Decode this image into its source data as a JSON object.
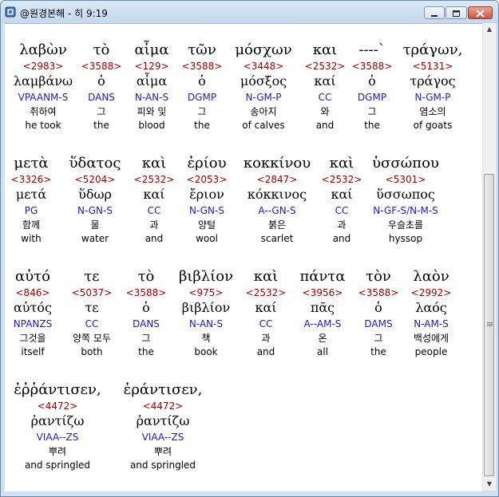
{
  "window": {
    "title": "@원경본해 - 히 9:19"
  },
  "words": [
    {
      "greek": "λαβὼν",
      "strong": "<2983>",
      "lemma": "λαμβάνω",
      "morph": "VPAANM-S",
      "korean": "취하여",
      "english": "he took"
    },
    {
      "greek": "τὸ",
      "strong": "<3588>",
      "lemma": "ὁ",
      "morph": "DANS",
      "korean": "그",
      "english": "the"
    },
    {
      "greek": "αἷμα",
      "strong": "<129>",
      "lemma": "αἷμα",
      "morph": "N-AN-S",
      "korean": "피와 및",
      "english": "blood"
    },
    {
      "greek": "τῶν",
      "strong": "<3588>",
      "lemma": "ὁ",
      "morph": "DGMP",
      "korean": "그",
      "english": "the"
    },
    {
      "greek": "μόσχων",
      "strong": "<3448>",
      "lemma": "μόσξος",
      "morph": "N-GM-P",
      "korean": "송아지",
      "english": "of calves"
    },
    {
      "greek": "και",
      "strong": "<2532>",
      "lemma": "καί",
      "morph": "CC",
      "korean": "와",
      "english": "and"
    },
    {
      "greek": "----`",
      "strong": "<3588>",
      "lemma": "ὁ",
      "morph": "DGMP",
      "korean": "그",
      "english": "the"
    },
    {
      "greek": "τράγων,",
      "strong": "<5131>",
      "lemma": "τράγος",
      "morph": "N-GM-P",
      "korean": "염소의",
      "english": "of goats"
    },
    {
      "greek": "μετὰ",
      "strong": "<3326>",
      "lemma": "μετά",
      "morph": "PG",
      "korean": "함께",
      "english": "with"
    },
    {
      "greek": "ὕδατος",
      "strong": "<5204>",
      "lemma": "ὕδωρ",
      "morph": "N-GN-S",
      "korean": "물",
      "english": "water"
    },
    {
      "greek": "καὶ",
      "strong": "<2532>",
      "lemma": "καί",
      "morph": "CC",
      "korean": "과",
      "english": "and"
    },
    {
      "greek": "ἐρίου",
      "strong": "<2053>",
      "lemma": "ἔριον",
      "morph": "N-GN-S",
      "korean": "양털",
      "english": "wool"
    },
    {
      "greek": "κοκκίνου",
      "strong": "<2847>",
      "lemma": "κόκκινος",
      "morph": "A--GN-S",
      "korean": "붉은",
      "english": "scarlet"
    },
    {
      "greek": "καὶ",
      "strong": "<2532>",
      "lemma": "καί",
      "morph": "CC",
      "korean": "과",
      "english": "and"
    },
    {
      "greek": "ὑσσώπου",
      "strong": "<5301>",
      "lemma": "ὕσσωπος",
      "morph": "N-GF-S/N-M-S",
      "korean": "우슬초를",
      "english": "hyssop"
    },
    {
      "greek": "αὐτό",
      "strong": "<846>",
      "lemma": "αὐτός",
      "morph": "NPANZS",
      "korean": "그것을",
      "english": "itself"
    },
    {
      "greek": "τε",
      "strong": "<5037>",
      "lemma": "τε",
      "morph": "CC",
      "korean": "양쪽 모두",
      "english": "both"
    },
    {
      "greek": "τὸ",
      "strong": "<3588>",
      "lemma": "ὁ",
      "morph": "DANS",
      "korean": "그",
      "english": "the"
    },
    {
      "greek": "βιβλίον",
      "strong": "<975>",
      "lemma": "βιβλίον",
      "morph": "N-AN-S",
      "korean": "책",
      "english": "book"
    },
    {
      "greek": "καὶ",
      "strong": "<2532>",
      "lemma": "καί",
      "morph": "CC",
      "korean": "과",
      "english": "and"
    },
    {
      "greek": "πάντα",
      "strong": "<3956>",
      "lemma": "πᾶς",
      "morph": "A--AM-S",
      "korean": "온",
      "english": "all"
    },
    {
      "greek": "τὸν",
      "strong": "<3588>",
      "lemma": "ὁ",
      "morph": "DAMS",
      "korean": "그",
      "english": "the"
    },
    {
      "greek": "λαὸν",
      "strong": "<2992>",
      "lemma": "λαός",
      "morph": "N-AM-S",
      "korean": "백성에게",
      "english": "people"
    },
    {
      "greek": "ἐῤῥάντισεν,",
      "strong": "<4472>",
      "lemma": "ῥαντίζω",
      "morph": "VIAA--ZS",
      "korean": "뿌려",
      "english": "and springled"
    },
    {
      "greek": "ἐράντισεν,",
      "strong": "<4472>",
      "lemma": "ῥαντίζω",
      "morph": "VIAA--ZS",
      "korean": "뿌려",
      "english": "and springled"
    }
  ]
}
